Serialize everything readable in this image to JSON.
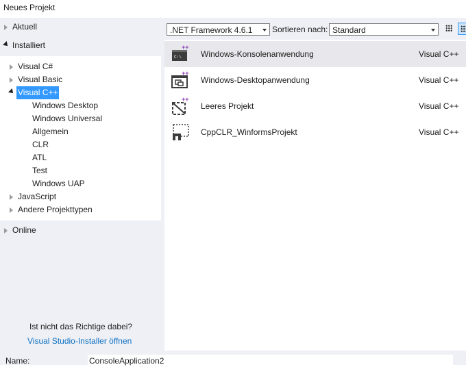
{
  "window": {
    "title": "Neues Projekt"
  },
  "sidebar": {
    "aktuell": "Aktuell",
    "installiert": "Installiert",
    "tree": [
      {
        "label": "Visual C#"
      },
      {
        "label": "Visual Basic"
      },
      {
        "label": "Visual C++",
        "selected": true
      },
      {
        "label": "Windows Desktop"
      },
      {
        "label": "Windows Universal"
      },
      {
        "label": "Allgemein"
      },
      {
        "label": "CLR"
      },
      {
        "label": "ATL"
      },
      {
        "label": "Test"
      },
      {
        "label": "Windows UAP"
      },
      {
        "label": "JavaScript"
      },
      {
        "label": "Andere Projekttypen"
      }
    ],
    "online": "Online",
    "help_text": "Ist nicht das Richtige dabei?",
    "help_link": "Visual Studio-Installer öffnen"
  },
  "toolbar": {
    "framework": ".NET Framework 4.6.1",
    "sort_label": "Sortieren nach:",
    "sort_value": "Standard"
  },
  "templates": [
    {
      "name": "Windows-Konsolenanwendung",
      "lang": "Visual C++",
      "icon": "console-app-icon",
      "selected": true
    },
    {
      "name": "Windows-Desktopanwendung",
      "lang": "Visual C++",
      "icon": "desktop-app-icon"
    },
    {
      "name": "Leeres Projekt",
      "lang": "Visual C++",
      "icon": "empty-project-icon"
    },
    {
      "name": "CppCLR_WinformsProjekt",
      "lang": "Visual C++",
      "icon": "winforms-project-icon"
    }
  ],
  "form": {
    "name_label": "Name:",
    "name_value": "ConsoleApplication2"
  },
  "colors": {
    "accent": "#3399ff",
    "plusplus": "#8a3fb5",
    "link": "#0e70c0"
  }
}
